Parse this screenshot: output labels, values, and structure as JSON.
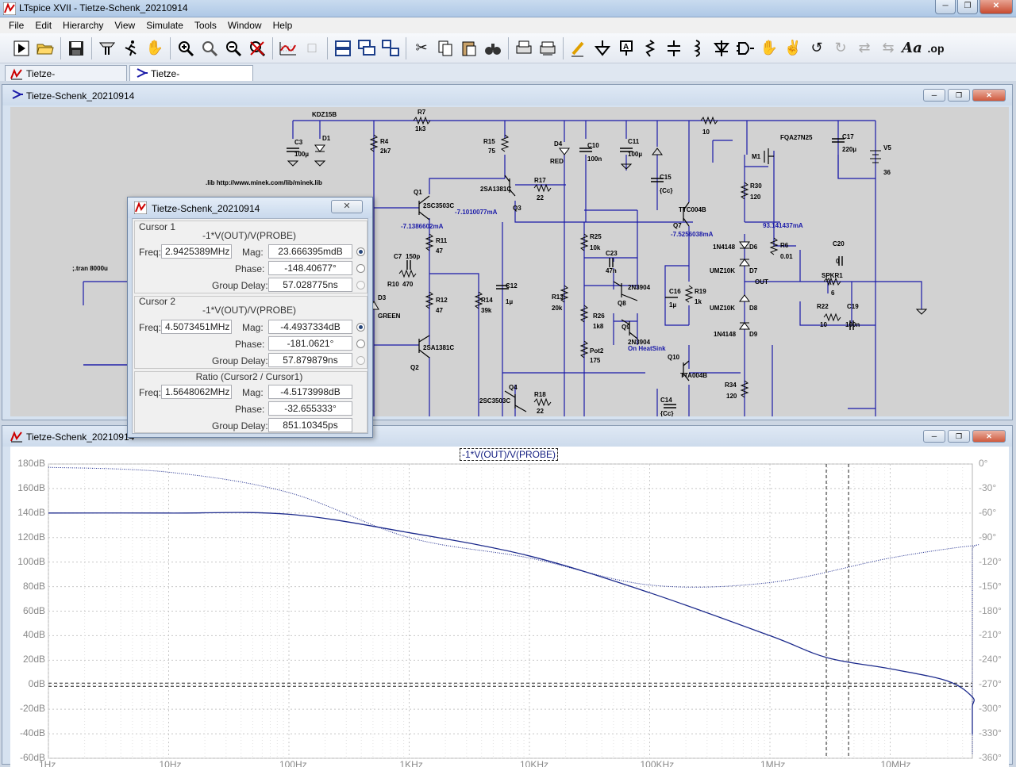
{
  "app": {
    "title": "LTspice XVII - Tietze-Schenk_20210914"
  },
  "menu": [
    "File",
    "Edit",
    "Hierarchy",
    "View",
    "Simulate",
    "Tools",
    "Window",
    "Help"
  ],
  "tabs": [
    {
      "label": "Tietze-Schenk_20210914",
      "kind": "waveform"
    },
    {
      "label": "Tietze-Schenk_20210914",
      "kind": "schematic"
    }
  ],
  "schematic_window": {
    "title": "Tietze-Schenk_20210914"
  },
  "waveform_window": {
    "title": "Tietze-Schenk_20210914",
    "trace_label": "-1*V(OUT)/V(PROBE)"
  },
  "schematic": {
    "labels": {
      "kdz": "KDZ15B",
      "r7": "R7",
      "r7v": "1k3",
      "r_top": "10",
      "fqa": "FQA27N25",
      "c3": "C3",
      "c3v": "100µ",
      "d1": "D1",
      "r4": "R4",
      "r4v": "2k7",
      "r15": "R15",
      "r15v": "75",
      "d4": "D4",
      "d4v": "RED",
      "c10": "C10",
      "c10v": "100n",
      "c11": "C11",
      "c11v": "100µ",
      "c17": "C17",
      "c17v": "220µ",
      "v5": "V5",
      "v5v": "36",
      "m1": "M1",
      "lib": ".lib http://www.minek.com/lib/minek.lib",
      "q1": "Q1",
      "q1m": "2SC3503C",
      "q1i": "-7.1386602mA",
      "q3m": "2SA1381C",
      "q3": "Q3",
      "r17": "R17",
      "r17v": "22",
      "q3i": "-7.1010077mA",
      "c15": "C15",
      "c15v": "{Cc}",
      "r30": "R30",
      "r30v": "120",
      "q7m": "TTC004B",
      "q7": "Q7",
      "q7i": "-7.5256038mA",
      "m1i": "93.141437mA",
      "r11": "R11",
      "r11v": "47",
      "r25": "R25",
      "r25v": "10k",
      "d6m": "1N4148",
      "d6": "D6",
      "r6": "R6",
      "r6v": "0.01",
      "c20": "C20",
      "c20v": "0",
      "c7": "C7",
      "c7v": "150p",
      "c23": "C23",
      "c23v": "47n",
      "d7m": "UMZ10K",
      "d7": "D7",
      "out": "OUT",
      "spkr": "SPKR1",
      "spkrv": "6",
      "tran": ";.tran 8000u",
      "r10": "R10",
      "r10v": "470",
      "c12": "C12",
      "c12v": "1µ",
      "q8m": "2N3904",
      "q8": "Q8",
      "c16": "C16",
      "c16v": "1µ",
      "r19": "R19",
      "r19v": "1k",
      "d3": "D3",
      "d3v": "GREEN",
      "r12": "R12",
      "r12v": "47",
      "r14": "R14",
      "r14v": "39k",
      "r13": "R13",
      "r13v": "20k",
      "r26": "R26",
      "r26v": "1k8",
      "d8m": "UMZ10K",
      "d8": "D8",
      "r22": "R22",
      "r22v": "10",
      "c19": "C19",
      "c19v": "100n",
      "q9": "Q9",
      "q9m": "2N3904",
      "q9n": "On HeatSink",
      "d9m": "1N4148",
      "d9": "D9",
      "q2m": "2SA1381C",
      "q2": "Q2",
      "pot2": "Pot2",
      "pot2v": "175",
      "q10": "Q10",
      "q10m": "TTA004B",
      "r34": "R34",
      "r34v": "120",
      "q4": "Q4",
      "q4m": "2SC3503C",
      "r18": "R18",
      "r18v": "22",
      "c14": "C14",
      "c14v": "{Cc}"
    }
  },
  "cursor_dialog": {
    "title": "Tietze-Schenk_20210914",
    "cursor1": {
      "caption": "Cursor 1",
      "expr": "-1*V(OUT)/V(PROBE)",
      "freq_label": "Freq:",
      "freq": "2.9425389MHz",
      "mag_label": "Mag:",
      "mag": "23.666395mdB",
      "phase_label": "Phase:",
      "phase": "-148.40677°",
      "gd_label": "Group Delay:",
      "gd": "57.028775ns"
    },
    "cursor2": {
      "caption": "Cursor 2",
      "expr": "-1*V(OUT)/V(PROBE)",
      "freq_label": "Freq:",
      "freq": "4.5073451MHz",
      "mag_label": "Mag:",
      "mag": "-4.4937334dB",
      "phase_label": "Phase:",
      "phase": "-181.0621°",
      "gd_label": "Group Delay:",
      "gd": "57.879879ns"
    },
    "ratio": {
      "caption": "Ratio (Cursor2 / Cursor1)",
      "freq_label": "Freq:",
      "freq": "1.5648062MHz",
      "mag_label": "Mag:",
      "mag": "-4.5173998dB",
      "phase_label": "Phase:",
      "phase": "-32.655333°",
      "gd_label": "Group Delay:",
      "gd": "851.10345ps"
    }
  },
  "chart_data": {
    "type": "line",
    "title": "-1*V(OUT)/V(PROBE)",
    "x_scale": "log",
    "xlim_hz": [
      1,
      30000000
    ],
    "x_tick_labels": [
      "1Hz",
      "10Hz",
      "100Hz",
      "1KHz",
      "10KHz",
      "100KHz",
      "1MHz",
      "10MHz"
    ],
    "x_tick_values_hz": [
      1,
      10,
      100,
      1000,
      10000,
      100000,
      1000000,
      10000000
    ],
    "ylim_left_db": [
      -60,
      180
    ],
    "y_left_tick_labels": [
      "180dB",
      "160dB",
      "140dB",
      "120dB",
      "100dB",
      "80dB",
      "60dB",
      "40dB",
      "20dB",
      "0dB",
      "-20dB",
      "-40dB",
      "-60dB"
    ],
    "ylim_right_deg": [
      -360,
      0
    ],
    "y_right_tick_labels": [
      "0°",
      "-30°",
      "-60°",
      "-90°",
      "-120°",
      "-150°",
      "-180°",
      "-210°",
      "-240°",
      "-270°",
      "-300°",
      "-330°",
      "-360°"
    ],
    "grid": true,
    "series": [
      {
        "axis": "left",
        "unit": "dB",
        "style": "solid",
        "color": "#1c2a8c",
        "points": [
          [
            1,
            140
          ],
          [
            10,
            140
          ],
          [
            100,
            139
          ],
          [
            1000,
            124
          ],
          [
            10000,
            105
          ],
          [
            100000,
            75
          ],
          [
            1000000,
            40
          ],
          [
            3000000,
            22
          ],
          [
            10000000,
            13
          ],
          [
            30000000,
            3
          ],
          [
            100000000,
            -10
          ],
          [
            1000000000,
            -18
          ],
          [
            3000000000,
            -35
          ],
          [
            10000000000,
            -40
          ],
          [
            30000000000,
            -40
          ]
        ]
      },
      {
        "axis": "right",
        "unit": "deg",
        "style": "dotted",
        "color": "#1c2a8c",
        "points": [
          [
            1,
            -4
          ],
          [
            10,
            -10
          ],
          [
            100,
            -35
          ],
          [
            1000,
            -90
          ],
          [
            10000,
            -115
          ],
          [
            100000,
            -148
          ],
          [
            1000000,
            -145
          ],
          [
            10000000,
            -115
          ],
          [
            100000000,
            -100
          ],
          [
            1000000000,
            -105
          ],
          [
            3000000000,
            -150
          ],
          [
            10000000000,
            -300
          ],
          [
            30000000000,
            -348
          ],
          [
            100000000000,
            -354
          ]
        ]
      }
    ],
    "cursors_hz": [
      2942538.9,
      4507345.1
    ],
    "zero_db_line": true
  },
  "colors": {
    "trace": "#1c2a8c",
    "wire": "#1a1aa8",
    "schematic_bg": "#d2d2d2",
    "plot_bg": "#ffffff"
  }
}
